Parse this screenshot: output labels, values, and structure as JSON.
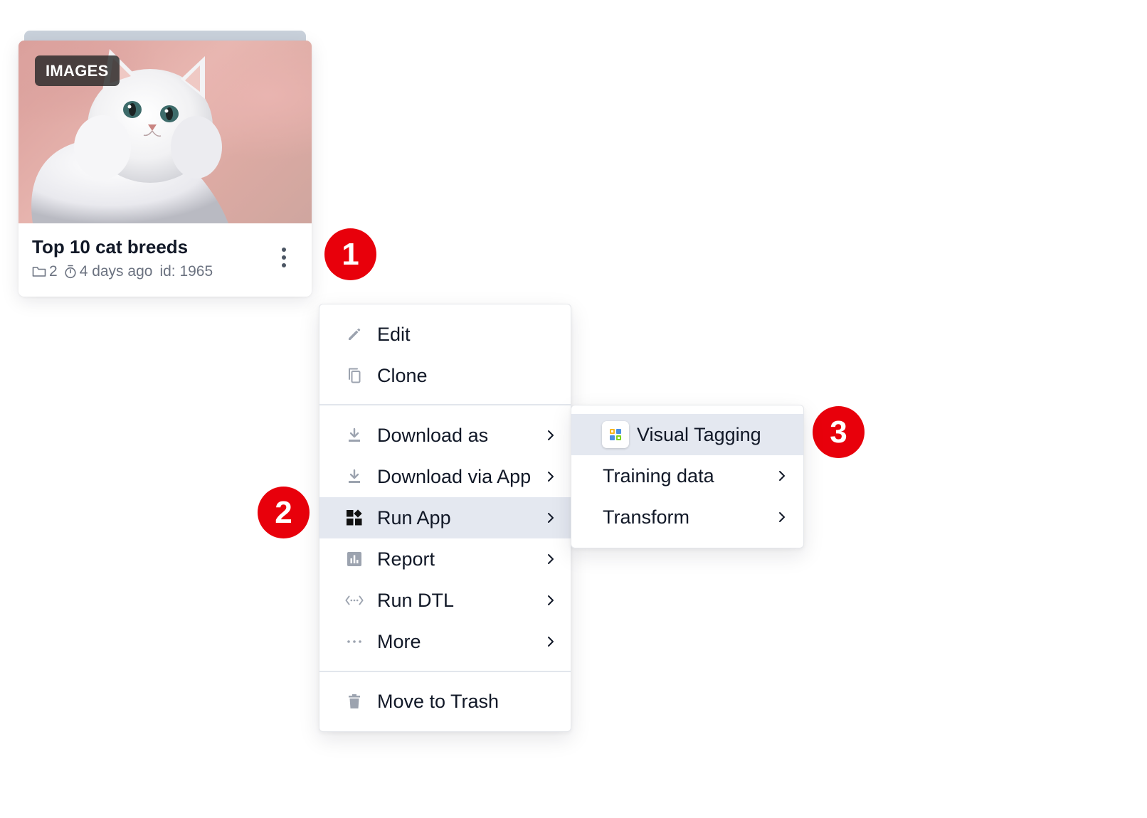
{
  "card": {
    "type_badge": "IMAGES",
    "title": "Top 10 cat breeds",
    "meta": {
      "folder_icon": "folder-icon",
      "datasets_count": "2",
      "timer_icon": "stopwatch-icon",
      "updated": "4 days ago",
      "id": "id: 1965"
    },
    "thumbnail_alt": "white persian cat",
    "menu_button_icon": "kebab-vertical-icon"
  },
  "markers": [
    "1",
    "2",
    "3"
  ],
  "context_menu": {
    "items": [
      {
        "label": "Edit",
        "icon": "pencil-icon",
        "has_submenu": false
      },
      {
        "label": "Clone",
        "icon": "copy-icon",
        "has_submenu": false
      },
      {
        "label": "Download as",
        "icon": "download-icon",
        "has_submenu": true
      },
      {
        "label": "Download via App",
        "icon": "download-icon",
        "has_submenu": true
      },
      {
        "label": "Run App",
        "icon": "apps-grid-icon",
        "has_submenu": true,
        "active": true
      },
      {
        "label": "Report",
        "icon": "chart-icon",
        "has_submenu": true
      },
      {
        "label": "Run DTL",
        "icon": "code-arrows-icon",
        "has_submenu": true
      },
      {
        "label": "More",
        "icon": "ellipsis-icon",
        "has_submenu": true
      },
      {
        "label": "Move to Trash",
        "icon": "trash-icon",
        "has_submenu": false
      }
    ]
  },
  "submenu": {
    "items": [
      {
        "label": "Visual Tagging",
        "icon": "visual-tagging-app-icon",
        "has_submenu": false,
        "active": true
      },
      {
        "label": "Training data",
        "has_submenu": true
      },
      {
        "label": "Transform",
        "has_submenu": true
      }
    ]
  },
  "colors": {
    "marker": "#e8000b",
    "active_row": "#e4e8f0",
    "menu_text": "#111827",
    "icon_gray": "#9ca3af",
    "badge_bg": "#282828"
  }
}
